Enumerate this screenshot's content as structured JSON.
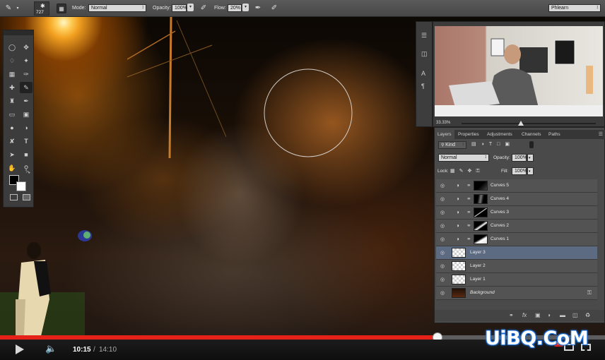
{
  "options_bar": {
    "brush_size": "727",
    "mode_label": "Mode:",
    "mode_value": "Normal",
    "opacity_label": "Opacity:",
    "opacity_value": "100%",
    "flow_label": "Flow:",
    "flow_value": "20%",
    "workspace": "Phlearn"
  },
  "video_thumb": {
    "zoom": "33.33%"
  },
  "layers_panel": {
    "tabs": [
      "Layers",
      "Properties",
      "Adjustments",
      "Channels",
      "Paths"
    ],
    "filter_kind": "Kind",
    "blend_mode": "Normal",
    "opacity_label": "Opacity:",
    "opacity_value": "100%",
    "lock_label": "Lock:",
    "fill_label": "Fill:",
    "fill_value": "100%",
    "layers": [
      {
        "name": "Curves 5",
        "type": "adjustment"
      },
      {
        "name": "Curves 4",
        "type": "adjustment"
      },
      {
        "name": "Curves 3",
        "type": "adjustment"
      },
      {
        "name": "Curves 2",
        "type": "adjustment"
      },
      {
        "name": "Curves 1",
        "type": "adjustment"
      },
      {
        "name": "Layer 3",
        "type": "pixel",
        "selected": true
      },
      {
        "name": "Layer 2",
        "type": "pixel"
      },
      {
        "name": "Layer 1",
        "type": "pixel"
      },
      {
        "name": "Background",
        "type": "background",
        "locked": true
      }
    ],
    "footer_icons": [
      "link-icon",
      "fx-icon",
      "mask-icon",
      "adjustment-icon",
      "folder-icon",
      "new-layer-icon",
      "trash-icon"
    ]
  },
  "player": {
    "current_time": "10:15",
    "separator": "/",
    "duration": "14:10",
    "progress_fraction": 0.7235,
    "hd_badge": "HD",
    "played_color": "#e62117"
  },
  "watermark": "UiBQ.CoM",
  "colors": {
    "accent": "#e62117",
    "selected_layer": "#5c6a82"
  }
}
